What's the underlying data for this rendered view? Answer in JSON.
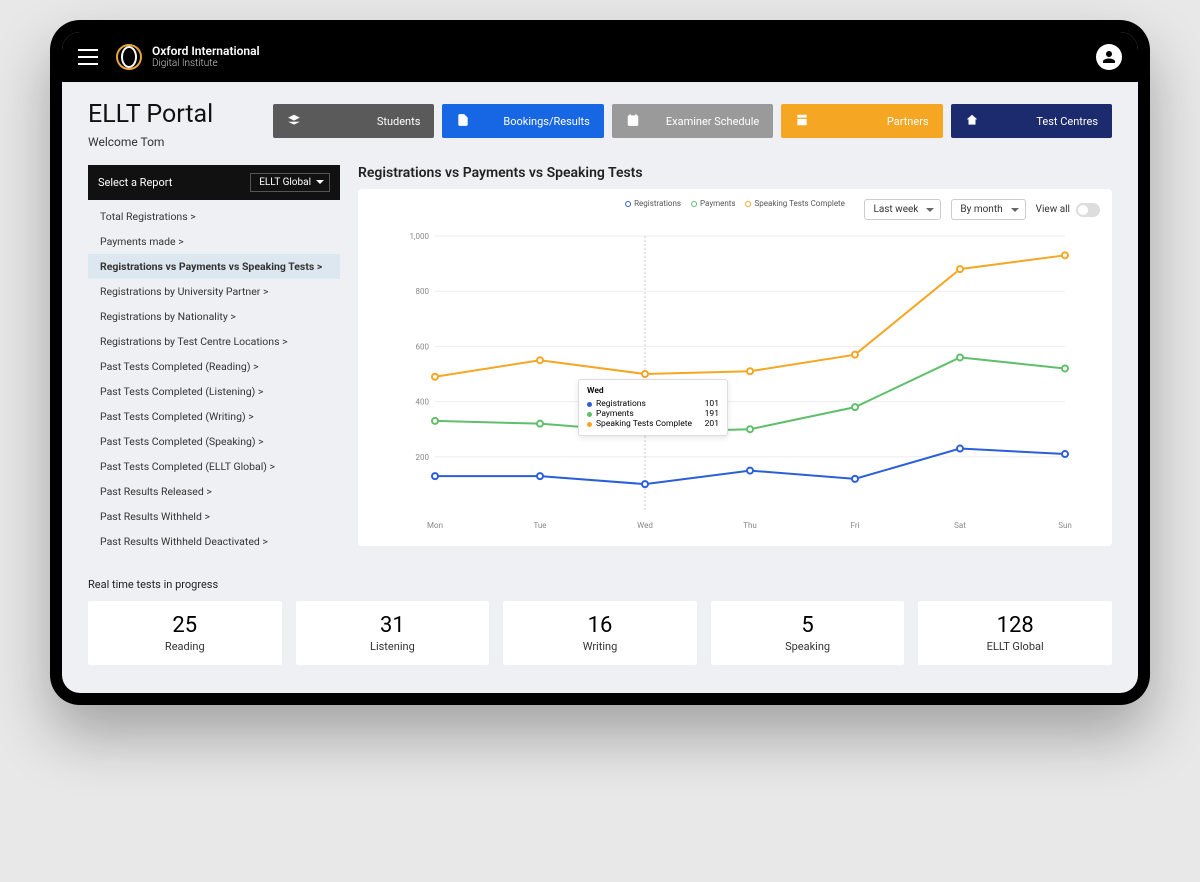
{
  "brand": {
    "line1": "Oxford International",
    "line2": "Digital Institute"
  },
  "header": {
    "title": "ELLT Portal",
    "welcome": "Welcome Tom"
  },
  "nav": [
    {
      "label": "Students",
      "color": "#5a5a5a"
    },
    {
      "label": "Bookings/Results",
      "color": "#1766e3"
    },
    {
      "label": "Examiner Schedule",
      "color": "#9a9a9a"
    },
    {
      "label": "Partners",
      "color": "#f5a623"
    },
    {
      "label": "Test Centres",
      "color": "#1c2a6e"
    }
  ],
  "sidebar": {
    "head_label": "Select a Report",
    "select_value": "ELLT Global",
    "items": [
      "Total Registrations >",
      "Payments made >",
      "Registrations vs Payments vs Speaking Tests >",
      "Registrations by University Partner >",
      "Registrations by Nationality >",
      "Registrations by Test Centre Locations >",
      "Past Tests Completed (Reading) >",
      "Past Tests Completed (Listening) >",
      "Past Tests Completed (Writing) >",
      "Past Tests Completed (Speaking) >",
      "Past Tests Completed (ELLT Global) >",
      "Past Results Released >",
      "Past Results Withheld >",
      "Past Results Withheld Deactivated >"
    ],
    "active_index": 2
  },
  "chart_title": "Registrations vs Payments vs Speaking Tests",
  "chart_controls": {
    "range": "Last week",
    "group": "By month",
    "viewall": "View all"
  },
  "chart_legend": [
    "Registrations",
    "Payments",
    "Speaking Tests Complete"
  ],
  "chart_colors": {
    "registrations": "#2b5fd9",
    "payments": "#5fbf6b",
    "speaking": "#f5a623"
  },
  "chart_data": {
    "type": "line",
    "categories": [
      "Mon",
      "Tue",
      "Wed",
      "Thu",
      "Fri",
      "Sat",
      "Sun"
    ],
    "y_ticks": [
      200,
      400,
      600,
      800,
      1000
    ],
    "ylim": [
      0,
      1000
    ],
    "series": [
      {
        "name": "Registrations",
        "values": [
          130,
          130,
          101,
          150,
          120,
          230,
          210
        ]
      },
      {
        "name": "Payments",
        "values": [
          330,
          320,
          290,
          300,
          380,
          560,
          520
        ]
      },
      {
        "name": "Speaking Tests Complete",
        "values": [
          490,
          550,
          500,
          510,
          570,
          880,
          930
        ]
      }
    ]
  },
  "tooltip": {
    "title": "Wed",
    "rows": [
      {
        "label": "Registrations",
        "value": "101",
        "color": "#2b5fd9"
      },
      {
        "label": "Payments",
        "value": "191",
        "color": "#5fbf6b"
      },
      {
        "label": "Speaking Tests Complete",
        "value": "201",
        "color": "#f5a623"
      }
    ]
  },
  "stats_title": "Real time tests in progress",
  "stats": [
    {
      "num": "25",
      "lbl": "Reading"
    },
    {
      "num": "31",
      "lbl": "Listening"
    },
    {
      "num": "16",
      "lbl": "Writing"
    },
    {
      "num": "5",
      "lbl": "Speaking"
    },
    {
      "num": "128",
      "lbl": "ELLT Global"
    }
  ]
}
